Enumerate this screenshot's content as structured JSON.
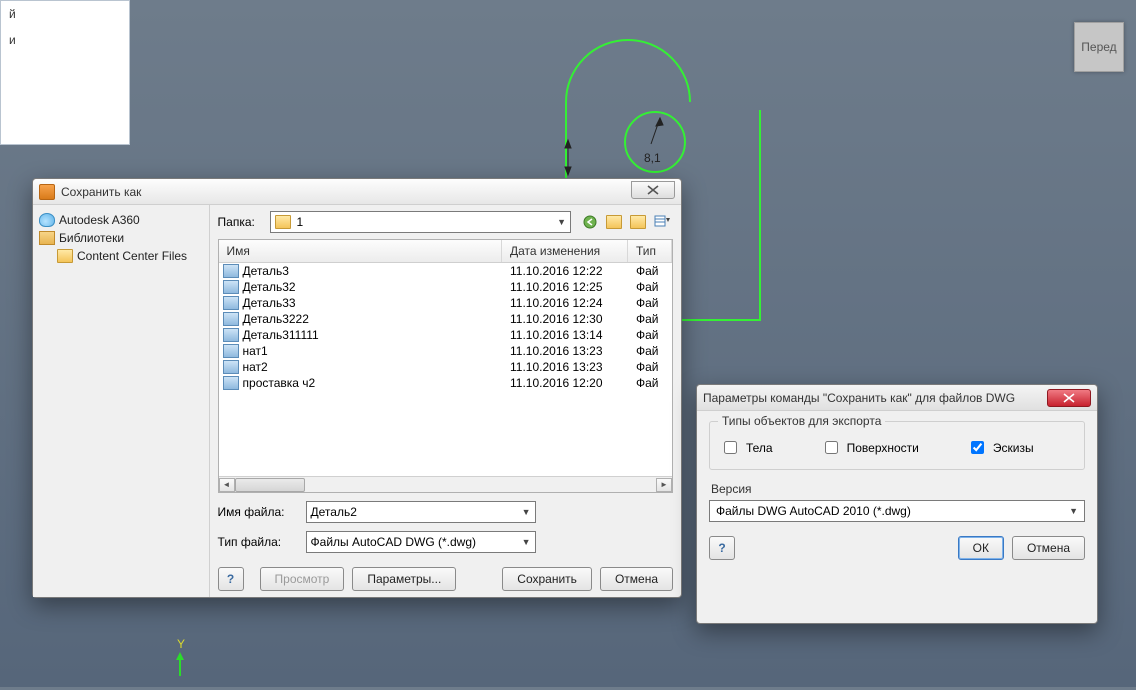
{
  "viewcube": {
    "label": "Перед"
  },
  "left_panel": {
    "item1": "й",
    "item2": "и"
  },
  "sketch_dim": "8,1",
  "save_dialog": {
    "title": "Сохранить как",
    "tree": {
      "a360": "Autodesk A360",
      "libs": "Библиотеки",
      "ccf": "Content Center Files"
    },
    "folder_label": "Папка:",
    "folder_value": "1",
    "columns": {
      "name": "Имя",
      "date": "Дата изменения",
      "type": "Тип"
    },
    "files": [
      {
        "name": "Деталь3",
        "date": "11.10.2016 12:22",
        "type": "Фай"
      },
      {
        "name": "Деталь32",
        "date": "11.10.2016 12:25",
        "type": "Фай"
      },
      {
        "name": "Деталь33",
        "date": "11.10.2016 12:24",
        "type": "Фай"
      },
      {
        "name": "Деталь3222",
        "date": "11.10.2016 12:30",
        "type": "Фай"
      },
      {
        "name": "Деталь311111",
        "date": "11.10.2016 13:14",
        "type": "Фай"
      },
      {
        "name": "нат1",
        "date": "11.10.2016 13:23",
        "type": "Фай"
      },
      {
        "name": "нат2",
        "date": "11.10.2016 13:23",
        "type": "Фай"
      },
      {
        "name": "проставка ч2",
        "date": "11.10.2016 12:20",
        "type": "Фай"
      }
    ],
    "filename_label": "Имя файла:",
    "filename_value": "Деталь2",
    "filetype_label": "Тип файла:",
    "filetype_value": "Файлы AutoCAD DWG (*.dwg)",
    "preview": "Просмотр",
    "params": "Параметры...",
    "save": "Сохранить",
    "cancel": "Отмена"
  },
  "options_dialog": {
    "title": "Параметры команды \"Сохранить как\" для файлов DWG",
    "group_title": "Типы объектов для экспорта",
    "chk_bodies": "Тела",
    "chk_surfaces": "Поверхности",
    "chk_sketches": "Эскизы",
    "chk_sketches_checked": true,
    "version_label": "Версия",
    "version_value": "Файлы DWG AutoCAD 2010 (*.dwg)",
    "ok": "ОК",
    "cancel": "Отмена"
  }
}
